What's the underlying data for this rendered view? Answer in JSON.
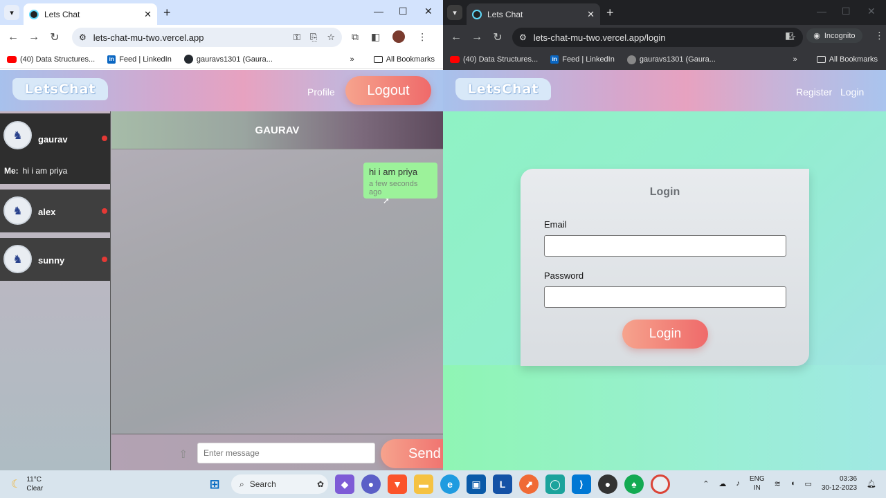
{
  "left_window": {
    "tab_title": "Lets Chat",
    "url": "lets-chat-mu-two.vercel.app",
    "bookmarks": [
      {
        "icon": "youtube-icon",
        "label": "(40) Data Structures..."
      },
      {
        "icon": "linkedin-icon",
        "label": "Feed | LinkedIn"
      },
      {
        "icon": "github-icon",
        "label": "gauravs1301 (Gaura..."
      }
    ],
    "all_bookmarks": "All Bookmarks",
    "app": {
      "logo": "LetsChat",
      "profile_link": "Profile",
      "logout_button": "Logout",
      "contacts": [
        {
          "name": "gaurav",
          "last_message_prefix": "Me:",
          "last_message": "hi i am priya",
          "active": true
        },
        {
          "name": "alex"
        },
        {
          "name": "sunny"
        }
      ],
      "chat_title": "GAURAV",
      "messages": [
        {
          "text": "hi i am priya",
          "time": "a few seconds ago"
        }
      ],
      "composer": {
        "placeholder": "Enter message",
        "send_button": "Send"
      }
    }
  },
  "right_window": {
    "tab_title": "Lets Chat",
    "url": "lets-chat-mu-two.vercel.app/login",
    "incognito_label": "Incognito",
    "bookmarks": [
      {
        "icon": "youtube-icon",
        "label": "(40) Data Structures..."
      },
      {
        "icon": "linkedin-icon",
        "label": "Feed | LinkedIn"
      },
      {
        "icon": "github-icon",
        "label": "gauravs1301 (Gaura..."
      }
    ],
    "all_bookmarks": "All Bookmarks",
    "app": {
      "logo": "LetsChat",
      "register_link": "Register",
      "login_link": "Login",
      "card_title": "Login",
      "email_label": "Email",
      "password_label": "Password",
      "login_button": "Login"
    }
  },
  "taskbar": {
    "weather_temp": "11°C",
    "weather_desc": "Clear",
    "search_label": "Search",
    "lang_line1": "ENG",
    "lang_line2": "IN",
    "time": "03:36",
    "date": "30-12-2023"
  },
  "colors": {
    "accent_button": "#ef6a6a",
    "message_bubble": "#9cf29a",
    "online_dot": "#e53935"
  }
}
